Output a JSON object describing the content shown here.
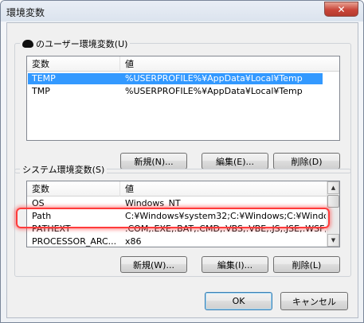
{
  "window": {
    "title": "環境変数",
    "close_glyph": "✕"
  },
  "user_vars": {
    "group_label": "のユーザー環境変数(U)",
    "col_name": "変数",
    "col_value": "値",
    "rows": [
      {
        "name": "TEMP",
        "value": "%USERPROFILE%¥AppData¥Local¥Temp",
        "selected": true
      },
      {
        "name": "TMP",
        "value": "%USERPROFILE%¥AppData¥Local¥Temp",
        "selected": false
      }
    ],
    "buttons": {
      "new": "新規(N)...",
      "edit": "編集(E)...",
      "delete": "削除(D)"
    }
  },
  "system_vars": {
    "group_label": "システム環境変数(S)",
    "col_name": "変数",
    "col_value": "値",
    "rows": [
      {
        "name": "OS",
        "value": "Windows_NT"
      },
      {
        "name": "Path",
        "value": "C:¥Windows¥system32;C:¥Windows;C:¥Window..."
      },
      {
        "name": "PATHEXT",
        "value": ".COM;.EXE;.BAT;.CMD;.VBS;.VBE;.JS;.JSE;.WSF;..."
      },
      {
        "name": "PROCESSOR_ARC...",
        "value": "x86"
      }
    ],
    "buttons": {
      "new": "新規(W)...",
      "edit": "編集(I)...",
      "delete": "削除(L)"
    }
  },
  "dialog_buttons": {
    "ok": "OK",
    "cancel": "キャンセル"
  },
  "colors": {
    "selection": "#3399ff",
    "highlight_ring": "#ff3b3b",
    "close_button": "#c9463a"
  },
  "icons": {
    "user": "user-avatar-icon",
    "scroll_up": "▲",
    "scroll_down": "▼"
  }
}
